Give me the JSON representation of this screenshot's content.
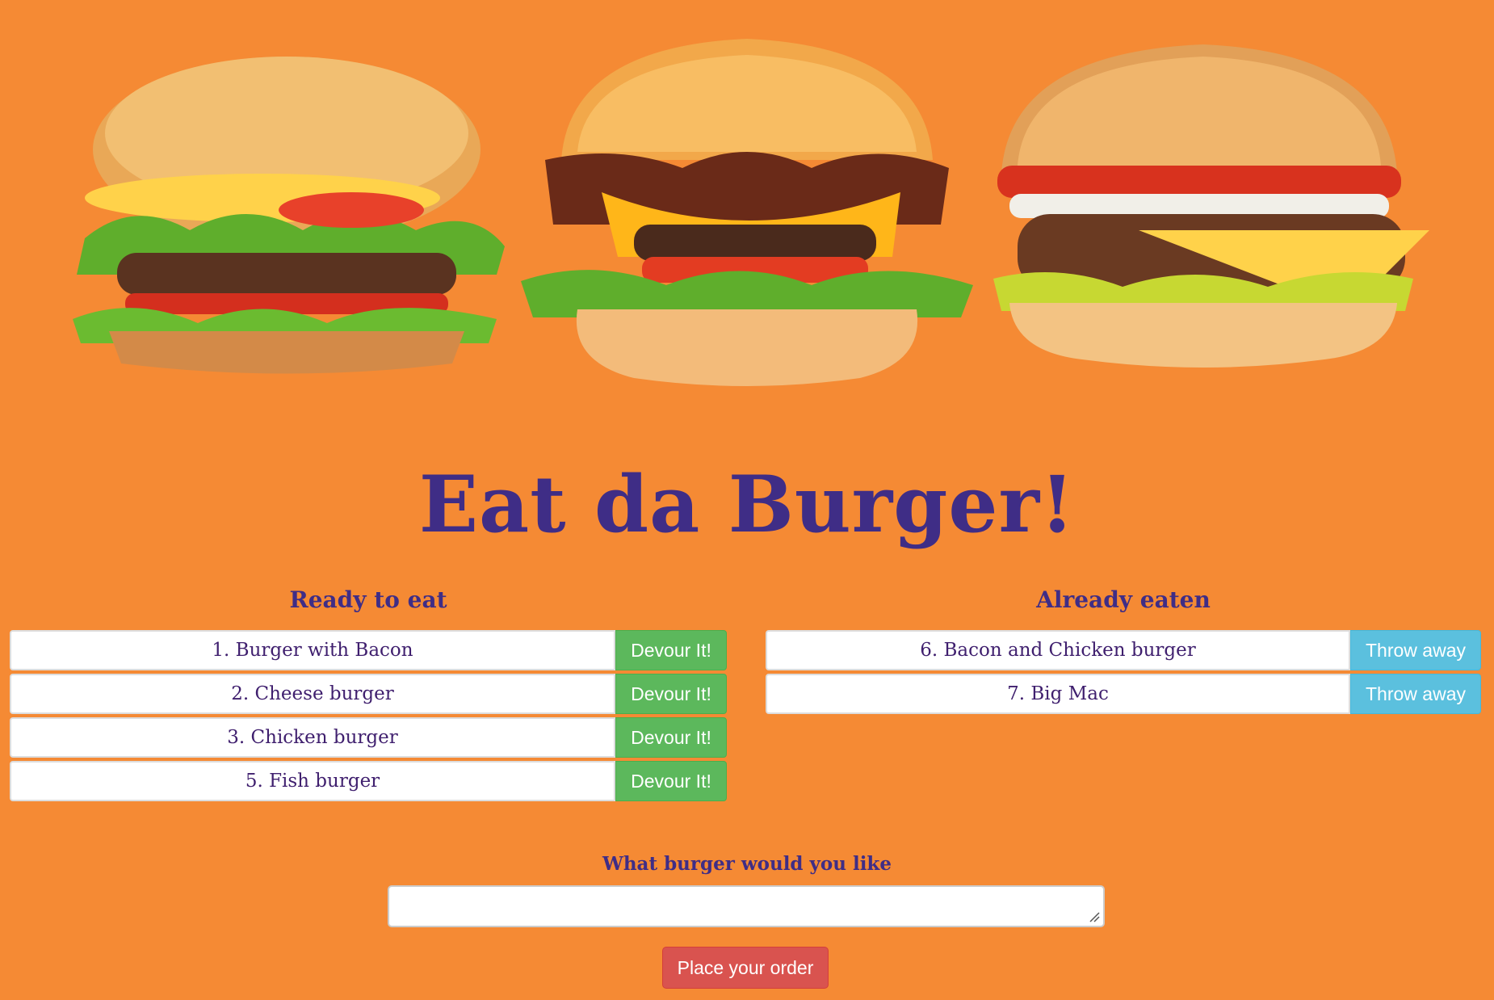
{
  "title": "Eat da Burger!",
  "ready": {
    "heading": "Ready to eat",
    "items": [
      {
        "label": "1. Burger with Bacon",
        "button": "Devour It!"
      },
      {
        "label": "2. Cheese burger",
        "button": "Devour It!"
      },
      {
        "label": "3. Chicken burger",
        "button": "Devour It!"
      },
      {
        "label": "5. Fish burger",
        "button": "Devour It!"
      }
    ]
  },
  "eaten": {
    "heading": "Already eaten",
    "items": [
      {
        "label": "6. Bacon and Chicken burger",
        "button": "Throw away"
      },
      {
        "label": "7. Big Mac",
        "button": "Throw away"
      }
    ]
  },
  "form": {
    "label": "What burger would you like",
    "input_value": "",
    "submit_label": "Place your order"
  },
  "colors": {
    "background": "#f58a34",
    "title": "#3f2d86",
    "devour": "#5cb85c",
    "throw": "#5bc0de",
    "order": "#d9534f"
  }
}
